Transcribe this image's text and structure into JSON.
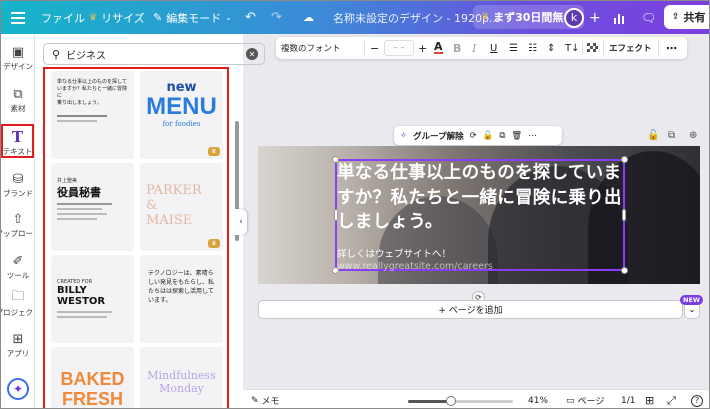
{
  "topbar": {
    "file_label": "ファイル",
    "resize_label": "リサイズ",
    "edit_mode_label": "編集モード",
    "design_title": "名称未設定のデザイン - 1920p...",
    "trial_label": "まず30日間無...",
    "avatar_letter": "k",
    "share_label": "共有",
    "crown_color": "#f3c24f"
  },
  "rail": {
    "items": [
      {
        "label": "デザイン",
        "icon": "layout-icon"
      },
      {
        "label": "素材",
        "icon": "shapes-icon"
      },
      {
        "label": "テキスト",
        "icon": "text-icon"
      },
      {
        "label": "ブランド",
        "icon": "brand-icon"
      },
      {
        "label": "アップロード",
        "icon": "upload-icon"
      },
      {
        "label": "ツール",
        "icon": "tools-icon"
      },
      {
        "label": "プロジェクト",
        "icon": "folder-icon"
      },
      {
        "label": "アプリ",
        "icon": "apps-icon"
      }
    ]
  },
  "panel": {
    "search_value": "ビジネス",
    "templates": {
      "card1_lines": [
        "単なる仕事以上のものを探して",
        "いますか？私たちと一緒に冒険に",
        "乗り出しましょう。"
      ],
      "card2_top": "new",
      "card2_main": "MENU",
      "card2_sub": "for foodies",
      "card3_small": "井上聖美",
      "card3_title": "役員秘書",
      "card4_text": "PARKER &\nMAISE",
      "card5_small": "CREATED FOR",
      "card5_title": "BILLY WESTOR",
      "card6_text": "テクノロジーは、素晴らしい発見をもたらし、私たちはは探索し活用しています。",
      "card7_text": "BAKED FRESH",
      "card8_text": "Mindfulness Monday"
    }
  },
  "toolbar": {
    "font_name": "複数のフォント",
    "minus": "−",
    "size_value": "– –",
    "plus": "+",
    "effects_label": "エフェクト"
  },
  "selection": {
    "ungroup_label": "グループ解除"
  },
  "canvas": {
    "headline": "単なる仕事以上のものを探していますか？私たちと一緒に冒険に乗り出しましょう。",
    "subline": "詳しくはウェブサイトへ！",
    "url": "www.reallygreatsite.com/careers",
    "accent_color": "#8b3dff"
  },
  "add_page_label": "+ ページを追加",
  "new_badge": "NEW",
  "bottombar": {
    "memo_label": "メモ",
    "zoom_label": "41%",
    "zoom_fraction": 0.41,
    "pages_label": "ページ",
    "page_count": "1/1"
  }
}
